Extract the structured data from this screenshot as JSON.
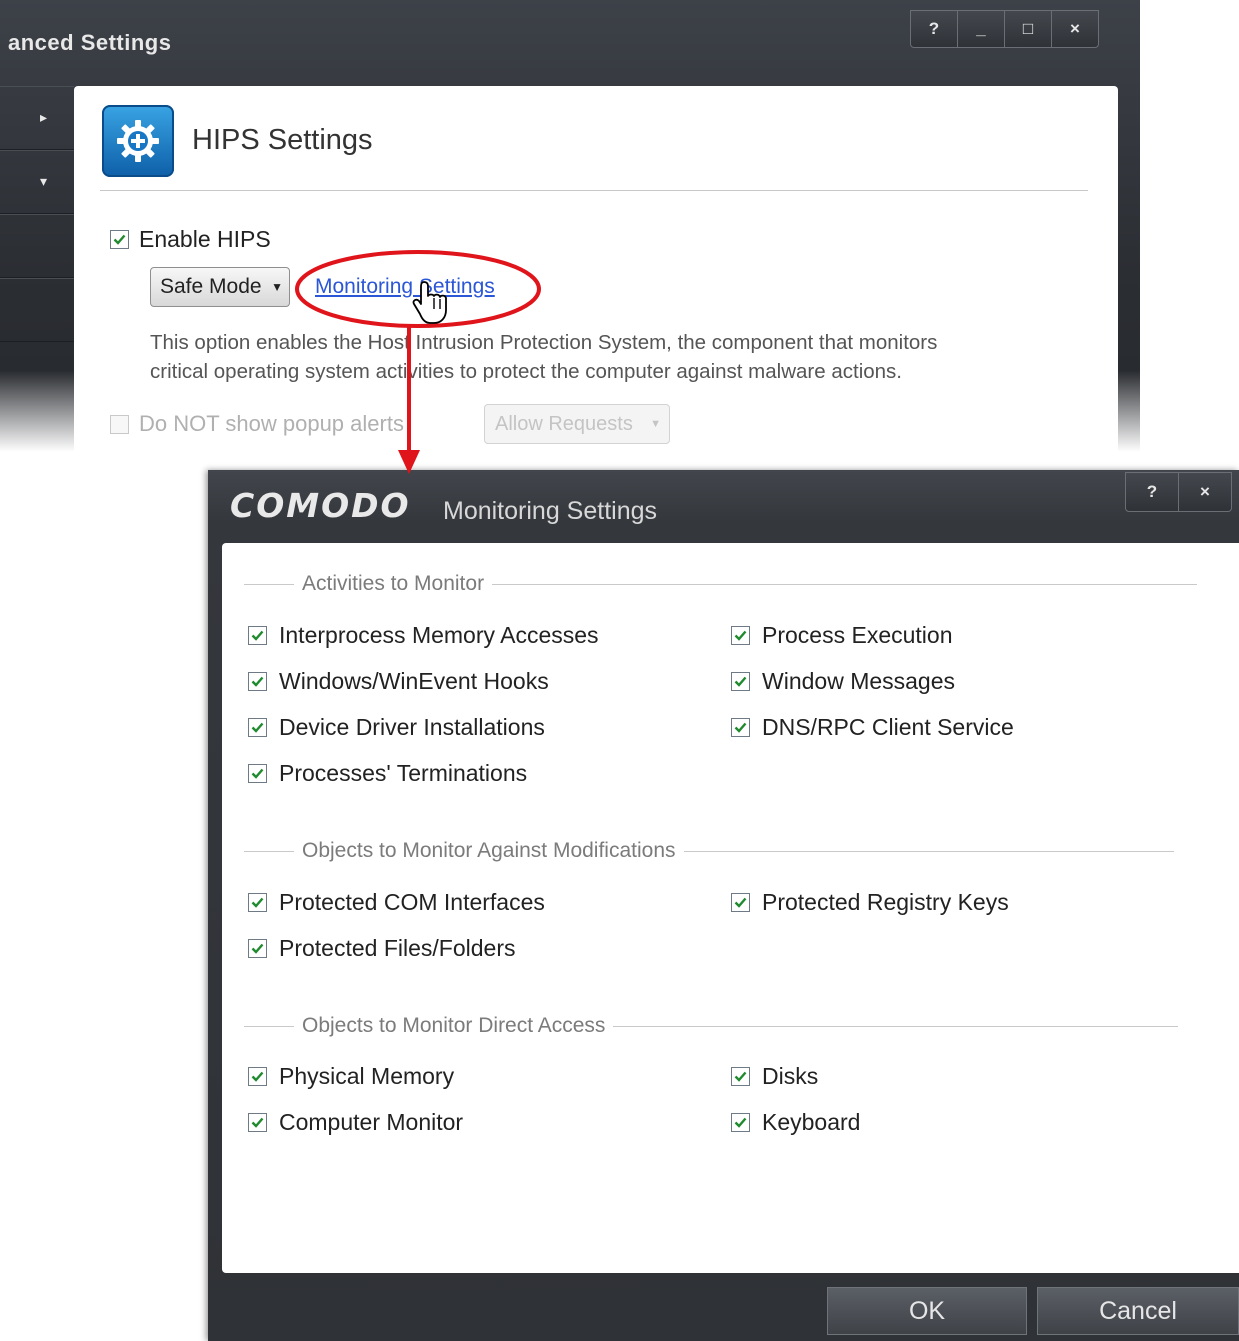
{
  "back_window": {
    "title": "anced Settings",
    "window_buttons": [
      "?",
      "_",
      "□",
      "×"
    ],
    "sidebar_arrows": [
      "▸",
      "▾"
    ],
    "panel": {
      "title": "HIPS Settings",
      "icon": "hips-gear-icon",
      "enable_hips_label": "Enable HIPS",
      "enable_hips_checked": true,
      "mode_select_value": "Safe Mode",
      "monitoring_link": "Monitoring Settings",
      "description_line1": "This option enables the Host Intrusion Protection System, the component that monitors",
      "description_line2": "critical operating system activities to protect the computer against malware actions.",
      "popup_alerts_label": "Do NOT show popup alerts",
      "popup_alerts_checked": false,
      "popup_select_value": "Allow Requests"
    }
  },
  "dialog": {
    "logo": "COMODO",
    "title": "Monitoring Settings",
    "window_buttons": [
      "?",
      "×"
    ],
    "groups": [
      {
        "legend": "Activities to Monitor",
        "options": [
          {
            "label": "Interprocess Memory Accesses",
            "checked": true
          },
          {
            "label": "Process Execution",
            "checked": true
          },
          {
            "label": "Windows/WinEvent Hooks",
            "checked": true
          },
          {
            "label": "Window Messages",
            "checked": true
          },
          {
            "label": "Device Driver Installations",
            "checked": true
          },
          {
            "label": "DNS/RPC Client Service",
            "checked": true
          },
          {
            "label": "Processes' Terminations",
            "checked": true
          }
        ]
      },
      {
        "legend": "Objects to Monitor Against Modifications",
        "options": [
          {
            "label": "Protected COM Interfaces",
            "checked": true
          },
          {
            "label": "Protected Registry Keys",
            "checked": true
          },
          {
            "label": "Protected Files/Folders",
            "checked": true
          }
        ]
      },
      {
        "legend": "Objects to Monitor Direct Access",
        "options": [
          {
            "label": "Physical Memory",
            "checked": true
          },
          {
            "label": "Disks",
            "checked": true
          },
          {
            "label": "Computer Monitor",
            "checked": true
          },
          {
            "label": "Keyboard",
            "checked": true
          }
        ]
      }
    ],
    "ok_label": "OK",
    "cancel_label": "Cancel"
  },
  "colors": {
    "accent_red": "#e0141b",
    "link_blue": "#2b56d6",
    "check_green": "#1f8a2e"
  }
}
